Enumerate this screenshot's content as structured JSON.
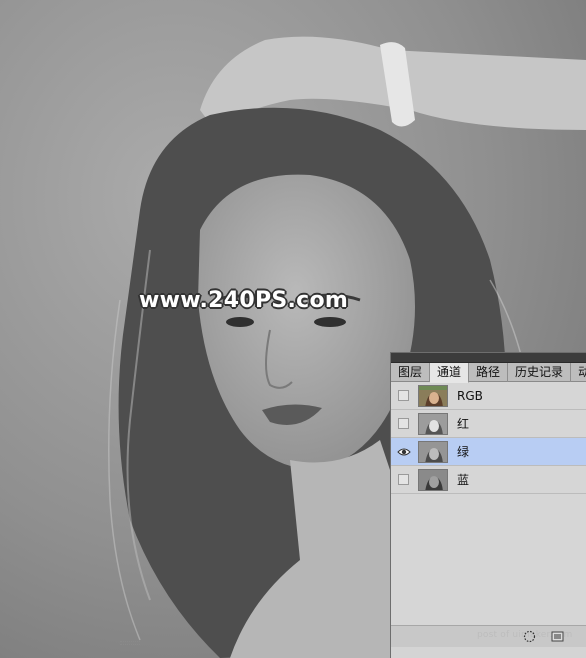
{
  "canvas": {
    "watermark": "www.240PS.com"
  },
  "channels_panel": {
    "tabs": [
      {
        "label": "图层",
        "active": false
      },
      {
        "label": "通道",
        "active": true
      },
      {
        "label": "路径",
        "active": false
      },
      {
        "label": "历史记录",
        "active": false
      },
      {
        "label": "动作",
        "active": false
      }
    ],
    "channels": [
      {
        "label": "RGB",
        "visible": false,
        "selected": false,
        "thumbnail": "color"
      },
      {
        "label": "红",
        "visible": false,
        "selected": false,
        "thumbnail": "grayscale"
      },
      {
        "label": "绿",
        "visible": true,
        "selected": true,
        "thumbnail": "grayscale"
      },
      {
        "label": "蓝",
        "visible": false,
        "selected": false,
        "thumbnail": "grayscale"
      }
    ],
    "footer_credit": "post of uimaker.com",
    "icons": [
      "eye-icon",
      "dotted-selection-icon",
      "new-channel-icon"
    ]
  }
}
